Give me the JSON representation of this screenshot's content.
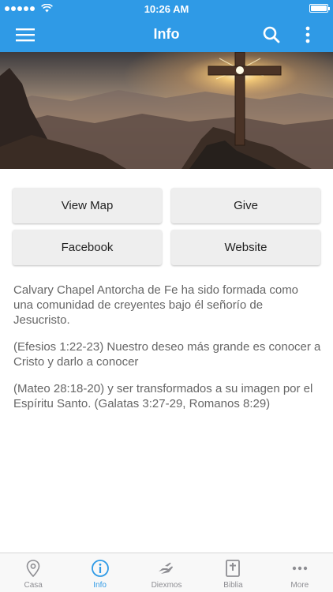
{
  "status_bar": {
    "time": "10:26 AM"
  },
  "nav": {
    "title": "Info",
    "menu_icon": "hamburger-menu-icon",
    "search_icon": "search-icon",
    "more_icon": "vertical-ellipsis-icon"
  },
  "hero": {
    "icon": "cross-mountain-sunset-image"
  },
  "buttons": {
    "view_map": "View Map",
    "give": "Give",
    "facebook": "Facebook",
    "website": "Website"
  },
  "description": {
    "paragraphs": [
      "Calvary Chapel Antorcha de Fe ha sido formada como una comunidad de creyentes bajo él señorío de Jesucristo.",
      "(Efesios 1:22-23) Nuestro deseo más grande es conocer a Cristo y darlo a conocer",
      "(Mateo 28:18-20) y ser transformados a su imagen por el Espíritu Santo. (Galatas 3:27-29, Romanos 8:29)"
    ]
  },
  "tabs": [
    {
      "label": "Casa",
      "icon": "map-pin-icon",
      "active": false
    },
    {
      "label": "Info",
      "icon": "info-icon",
      "active": true
    },
    {
      "label": "Diexmos",
      "icon": "giving-hand-icon",
      "active": false
    },
    {
      "label": "Biblia",
      "icon": "bible-icon",
      "active": false
    },
    {
      "label": "More",
      "icon": "horizontal-ellipsis-icon",
      "active": false
    }
  ],
  "colors": {
    "primary": "#2f9ae6",
    "tab_inactive": "#8e8e93",
    "button_bg": "#eeeeee",
    "text_gray": "#666666"
  }
}
